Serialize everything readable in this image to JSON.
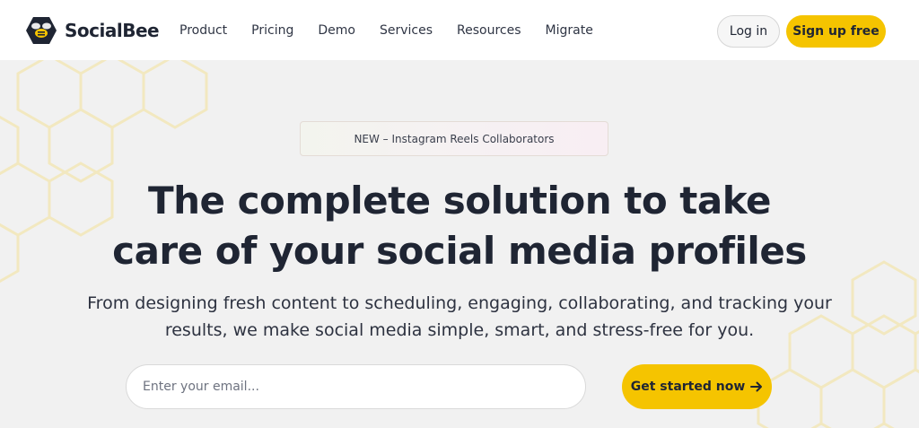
{
  "brand": {
    "name": "SocialBee",
    "logo_icon": "bee-hexagon-icon",
    "accent_color": "#f5c400",
    "dark_color": "#1f2533"
  },
  "nav": {
    "items": [
      {
        "label": "Product"
      },
      {
        "label": "Pricing"
      },
      {
        "label": "Demo"
      },
      {
        "label": "Services"
      },
      {
        "label": "Resources"
      },
      {
        "label": "Migrate"
      }
    ],
    "login_label": "Log in",
    "signup_label": "Sign up free"
  },
  "hero": {
    "badge": "NEW – Instagram Reels Collaborators",
    "headline_line1": "The complete solution to take",
    "headline_line2": "care of your social media profiles",
    "subtext_line1": "From designing fresh content to scheduling, engaging, collaborating, and tracking your",
    "subtext_line2": "results, we make social media simple, smart, and stress-free for you.",
    "email_placeholder": "Enter your email...",
    "cta_label": "Get started now",
    "cta_icon": "arrow-right-icon"
  }
}
